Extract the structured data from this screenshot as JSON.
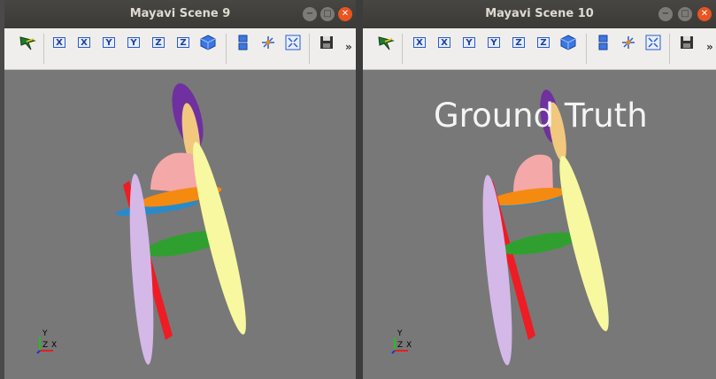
{
  "windows": [
    {
      "title": "Mayavi Scene 9",
      "window_controls": {
        "minimize": "−",
        "maximize": "□",
        "close": "✕"
      },
      "toolbar": {
        "axis_buttons": [
          "X",
          "X",
          "Y",
          "Y",
          "Z",
          "Z"
        ],
        "more": "»"
      },
      "overlay_text": "",
      "axes": {
        "x": "X",
        "y": "Y",
        "z": "Z"
      }
    },
    {
      "title": "Mayavi Scene 10",
      "window_controls": {
        "minimize": "−",
        "maximize": "□",
        "close": "✕"
      },
      "toolbar": {
        "axis_buttons": [
          "X",
          "X",
          "Y",
          "Y",
          "Z",
          "Z"
        ],
        "more": "»"
      },
      "overlay_text": "Ground Truth",
      "axes": {
        "x": "X",
        "y": "Y",
        "z": "Z"
      }
    }
  ],
  "colors": {
    "background": "#787878",
    "purple": "#7030a0",
    "tan": "#f2c87e",
    "pink": "#f4a8a8",
    "orange": "#f58a10",
    "blue": "#2a8ac8",
    "green": "#2fa02f",
    "lavender": "#d4b8e8",
    "red": "#ee1c24",
    "yellow": "#f8f8a0"
  }
}
